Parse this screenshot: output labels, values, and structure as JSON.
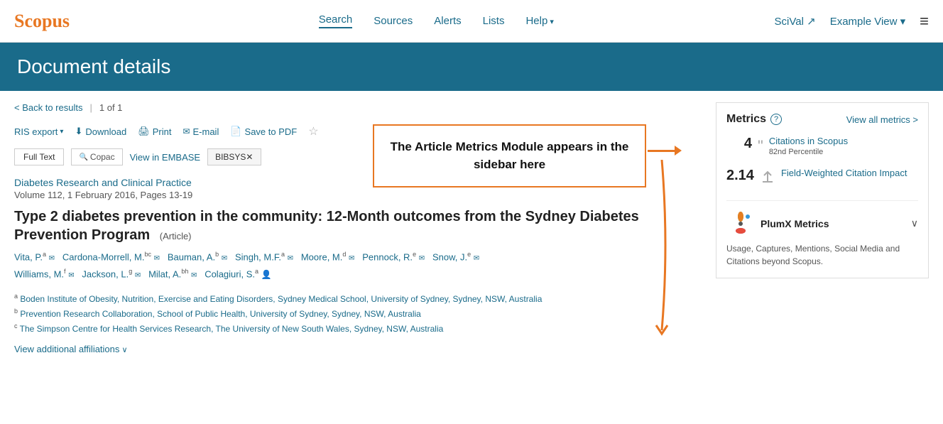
{
  "header": {
    "logo": "Scopus",
    "nav": [
      {
        "label": "Search",
        "active": true
      },
      {
        "label": "Sources",
        "active": false
      },
      {
        "label": "Alerts",
        "active": false
      },
      {
        "label": "Lists",
        "active": false
      },
      {
        "label": "Help",
        "has_arrow": true
      },
      {
        "label": "SciVal",
        "external": true
      },
      {
        "label": "Example View",
        "has_arrow": true
      }
    ]
  },
  "page": {
    "title": "Document details"
  },
  "doc": {
    "back_to_results": "Back to results",
    "page_indicator": "1 of 1",
    "actions": {
      "ris_export": "RIS export",
      "download": "Download",
      "print": "Print",
      "email": "E-mail",
      "save_to_pdf": "Save to PDF"
    },
    "buttons": {
      "full_text": "Full Text",
      "copac": "Copac",
      "view_in_embase": "View in EMBASE",
      "bibsys": "BIBSYS✕"
    },
    "journal_name": "Diabetes Research and Clinical Practice",
    "volume_info": "Volume 112, 1 February 2016, Pages 13-19",
    "article_title": "Type 2 diabetes prevention in the community: 12-Month outcomes from the Sydney Diabetes Prevention Program",
    "article_type": "(Article)",
    "authors_line1": "Vita, P.a  Cardona-Morrell, M.bc  Bauman, A.b  Singh, M.F.a  Moore, M.d  Pennock, R.e  Snow, J.e",
    "authors_line2": "Williams, M.f  Jackson, L.g  Milat, A.bh  Colagiuri, S.a",
    "affiliations": [
      "aBoden Institute of Obesity, Nutrition, Exercise and Eating Disorders, Sydney Medical School, University of Sydney, Sydney, NSW, Australia",
      "bPrevention Research Collaboration, School of Public Health, University of Sydney, Sydney, NSW, Australia",
      "cThe Simpson Centre for Health Services Research, The University of New South Wales, Sydney, NSW, Australia"
    ],
    "view_additional": "View additional affiliations"
  },
  "callout": {
    "text": "The Article Metrics Module appears in the sidebar here"
  },
  "metrics": {
    "title": "Metrics",
    "view_all": "View all metrics >",
    "citations_count": "4",
    "citations_label": "Citations in Scopus",
    "citations_percentile": "82nd Percentile",
    "fwci_value": "2.14",
    "fwci_label": "Field-Weighted Citation Impact",
    "plumx": {
      "label": "PlumX Metrics",
      "description": "Usage, Captures, Mentions, Social Media and Citations beyond Scopus."
    }
  }
}
